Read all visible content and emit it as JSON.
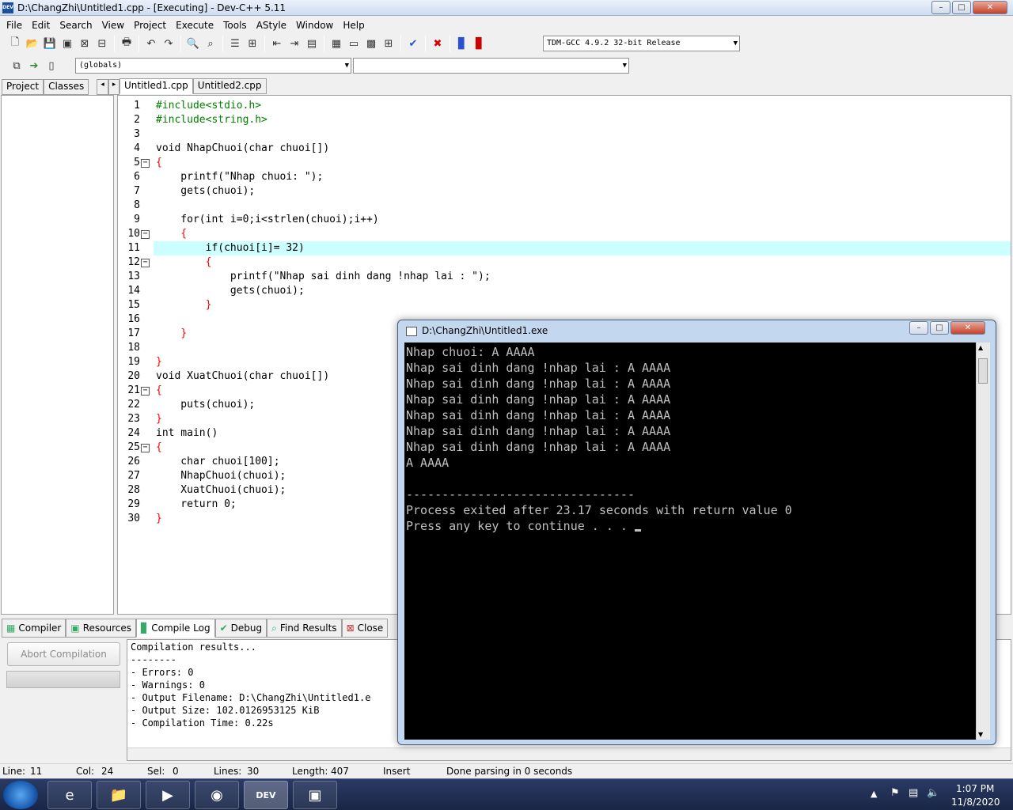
{
  "window": {
    "title": "D:\\ChangZhi\\Untitled1.cpp - [Executing] - Dev-C++ 5.11",
    "app_icon": "DEV"
  },
  "menu": [
    "File",
    "Edit",
    "Search",
    "View",
    "Project",
    "Execute",
    "Tools",
    "AStyle",
    "Window",
    "Help"
  ],
  "toolbar": {
    "compiler_select": "TDM-GCC 4.9.2 32-bit Release",
    "scope_select": "(globals)",
    "member_select": ""
  },
  "left_tabs": [
    "Project",
    "Classes"
  ],
  "editor_tabs": [
    "Untitled1.cpp",
    "Untitled2.cpp"
  ],
  "code": [
    "#include<stdio.h>",
    "#include<string.h>",
    "",
    "void NhapChuoi(char chuoi[])",
    "{",
    "    printf(\"Nhap chuoi: \");",
    "    gets(chuoi);",
    "",
    "    for(int i=0;i<strlen(chuoi);i++)",
    "    {",
    "        if(chuoi[i]= 32)",
    "        {",
    "            printf(\"Nhap sai dinh dang !nhap lai : \");",
    "            gets(chuoi);",
    "        }",
    "",
    "    }",
    "",
    "}",
    "void XuatChuoi(char chuoi[])",
    "{",
    "    puts(chuoi);",
    "}",
    "int main()",
    "{",
    "    char chuoi[100];",
    "    NhapChuoi(chuoi);",
    "    XuatChuoi(chuoi);",
    "    return 0;",
    "}"
  ],
  "bottom_tabs": [
    "Compiler",
    "Resources",
    "Compile Log",
    "Debug",
    "Find Results",
    "Close"
  ],
  "abort_button": "Abort Compilation",
  "compile_log": [
    "Compilation results...",
    "--------",
    "- Errors: 0",
    "- Warnings: 0",
    "- Output Filename: D:\\ChangZhi\\Untitled1.e",
    "- Output Size: 102.0126953125 KiB",
    "- Compilation Time: 0.22s"
  ],
  "statusbar": {
    "line_label": "Line:",
    "line": "11",
    "col_label": "Col:",
    "col": "24",
    "sel_label": "Sel:",
    "sel": "0",
    "lines_label": "Lines:",
    "lines": "30",
    "length_label": "Length:",
    "length": "407",
    "mode": "Insert",
    "message": "Done parsing in 0 seconds"
  },
  "console": {
    "title": "D:\\ChangZhi\\Untitled1.exe",
    "lines": [
      "Nhap chuoi: A AAAA",
      "Nhap sai dinh dang !nhap lai : A AAAA",
      "Nhap sai dinh dang !nhap lai : A AAAA",
      "Nhap sai dinh dang !nhap lai : A AAAA",
      "Nhap sai dinh dang !nhap lai : A AAAA",
      "Nhap sai dinh dang !nhap lai : A AAAA",
      "Nhap sai dinh dang !nhap lai : A AAAA",
      "A AAAA",
      "",
      "--------------------------------",
      "Process exited after 23.17 seconds with return value 0",
      "Press any key to continue . . . "
    ]
  },
  "taskbar": {
    "time": "1:07 PM",
    "date": "11/8/2020"
  }
}
